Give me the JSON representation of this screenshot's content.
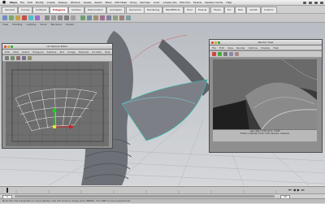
{
  "menubar": {
    "app_name": "Maya",
    "items": [
      "File",
      "Edit",
      "Modify",
      "Create",
      "Display",
      "Window",
      "Assets",
      "Select",
      "Mesh",
      "Edit Mesh",
      "Proxy",
      "Normals",
      "Color",
      "Create UVs",
      "Edit UVs",
      "Muscle",
      "Pipeline Cache",
      "Help"
    ],
    "window_title": "Autodesk Maya 2011 Hotbox - /Users/..."
  },
  "shelf": {
    "tabs": [
      "General",
      "Curves",
      "Surfaces",
      "Polygons",
      "Subdivs",
      "Deformation",
      "Animation",
      "Dynamics",
      "Rendering",
      "PaintEffects",
      "Toon",
      "Muscle",
      "Fluids",
      "Fur",
      "Hair",
      "nCloth",
      "Custom"
    ],
    "active_tab": "Polygons"
  },
  "viewport": {
    "menu": [
      "View",
      "Shading",
      "Lighting",
      "Show",
      "Renderer",
      "Panels"
    ]
  },
  "uv_editor": {
    "title": "UV Texture Editor",
    "menu": [
      "Edit",
      "View",
      "Select",
      "Polygons",
      "Subdivs",
      "Tool",
      "Image",
      "Textures",
      "UV Sets",
      "Help"
    ]
  },
  "render_view": {
    "title": "Render View",
    "menu": [
      "File",
      "Edit",
      "View",
      "Render",
      "Options",
      "Display",
      "Help"
    ],
    "info_lines": [
      "size: 960 x 540   zoom: 1.000",
      "Frame: 1   Render Time: 0:05   Camera: camera1"
    ]
  },
  "timeline": {
    "start_frame": "1",
    "end_frame": "24"
  },
  "help_line": "Move Tool: Use manipulator to move object(s). Use edit mode to change pivot (INSERT). Ctrl+LMB to move perpendicular."
}
